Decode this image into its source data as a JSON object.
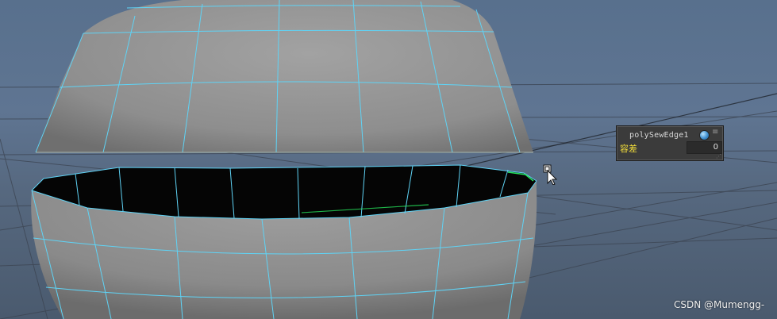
{
  "hud": {
    "node_name": "polySewEdge1",
    "attribute_label": "容差",
    "attribute_value": "0",
    "accent_label_color": "#f2dd3a"
  },
  "viewport": {
    "wireframe_color": "#5fd3f5",
    "selected_edge_color": "#26e05a",
    "background_top": "#58708d",
    "background_bottom": "#4a5a6e"
  },
  "watermark": "CSDN @Mumengg-"
}
